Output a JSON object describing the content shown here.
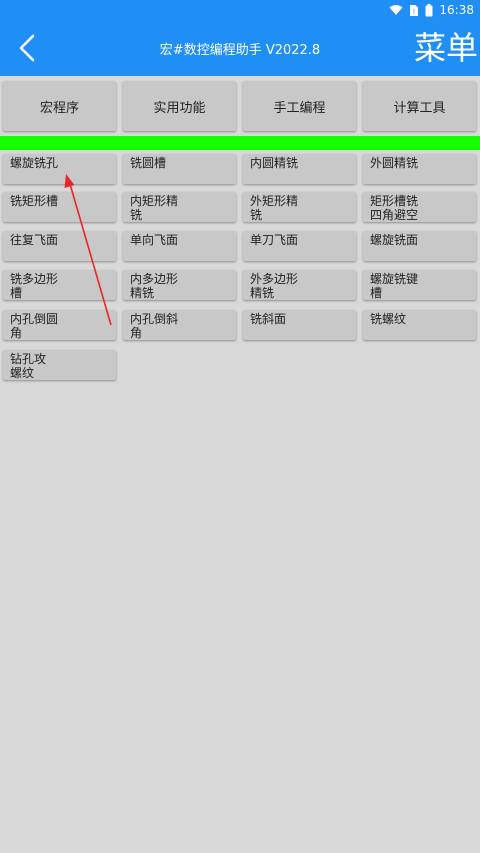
{
  "status": {
    "time": "16:38"
  },
  "header": {
    "title": "宏#数控编程助手 V2022.8",
    "menu_label": "菜单"
  },
  "tabs": [
    {
      "label": "宏程序"
    },
    {
      "label": "实用功能"
    },
    {
      "label": "手工编程"
    },
    {
      "label": "计算工具"
    }
  ],
  "functions": [
    "螺旋铣孔",
    "铣圆槽",
    "内圆精铣",
    "外圆精铣",
    "铣矩形槽",
    "内矩形精\n铣",
    "外矩形精\n铣",
    "矩形槽铣\n四角避空",
    "往复飞面",
    "单向飞面",
    "单刀飞面",
    "螺旋铣面",
    "铣多边形\n槽",
    "内多边形\n精铣",
    "外多边形\n精铣",
    "螺旋铣键\n槽",
    "内孔倒圆\n角",
    "内孔倒斜\n角",
    "铣斜面",
    "铣螺纹",
    "钻孔攻\n螺纹"
  ],
  "colors": {
    "appbar": "#1f8ef5",
    "accent_bar": "#16ff00",
    "annotation_arrow": "#e8262a"
  }
}
